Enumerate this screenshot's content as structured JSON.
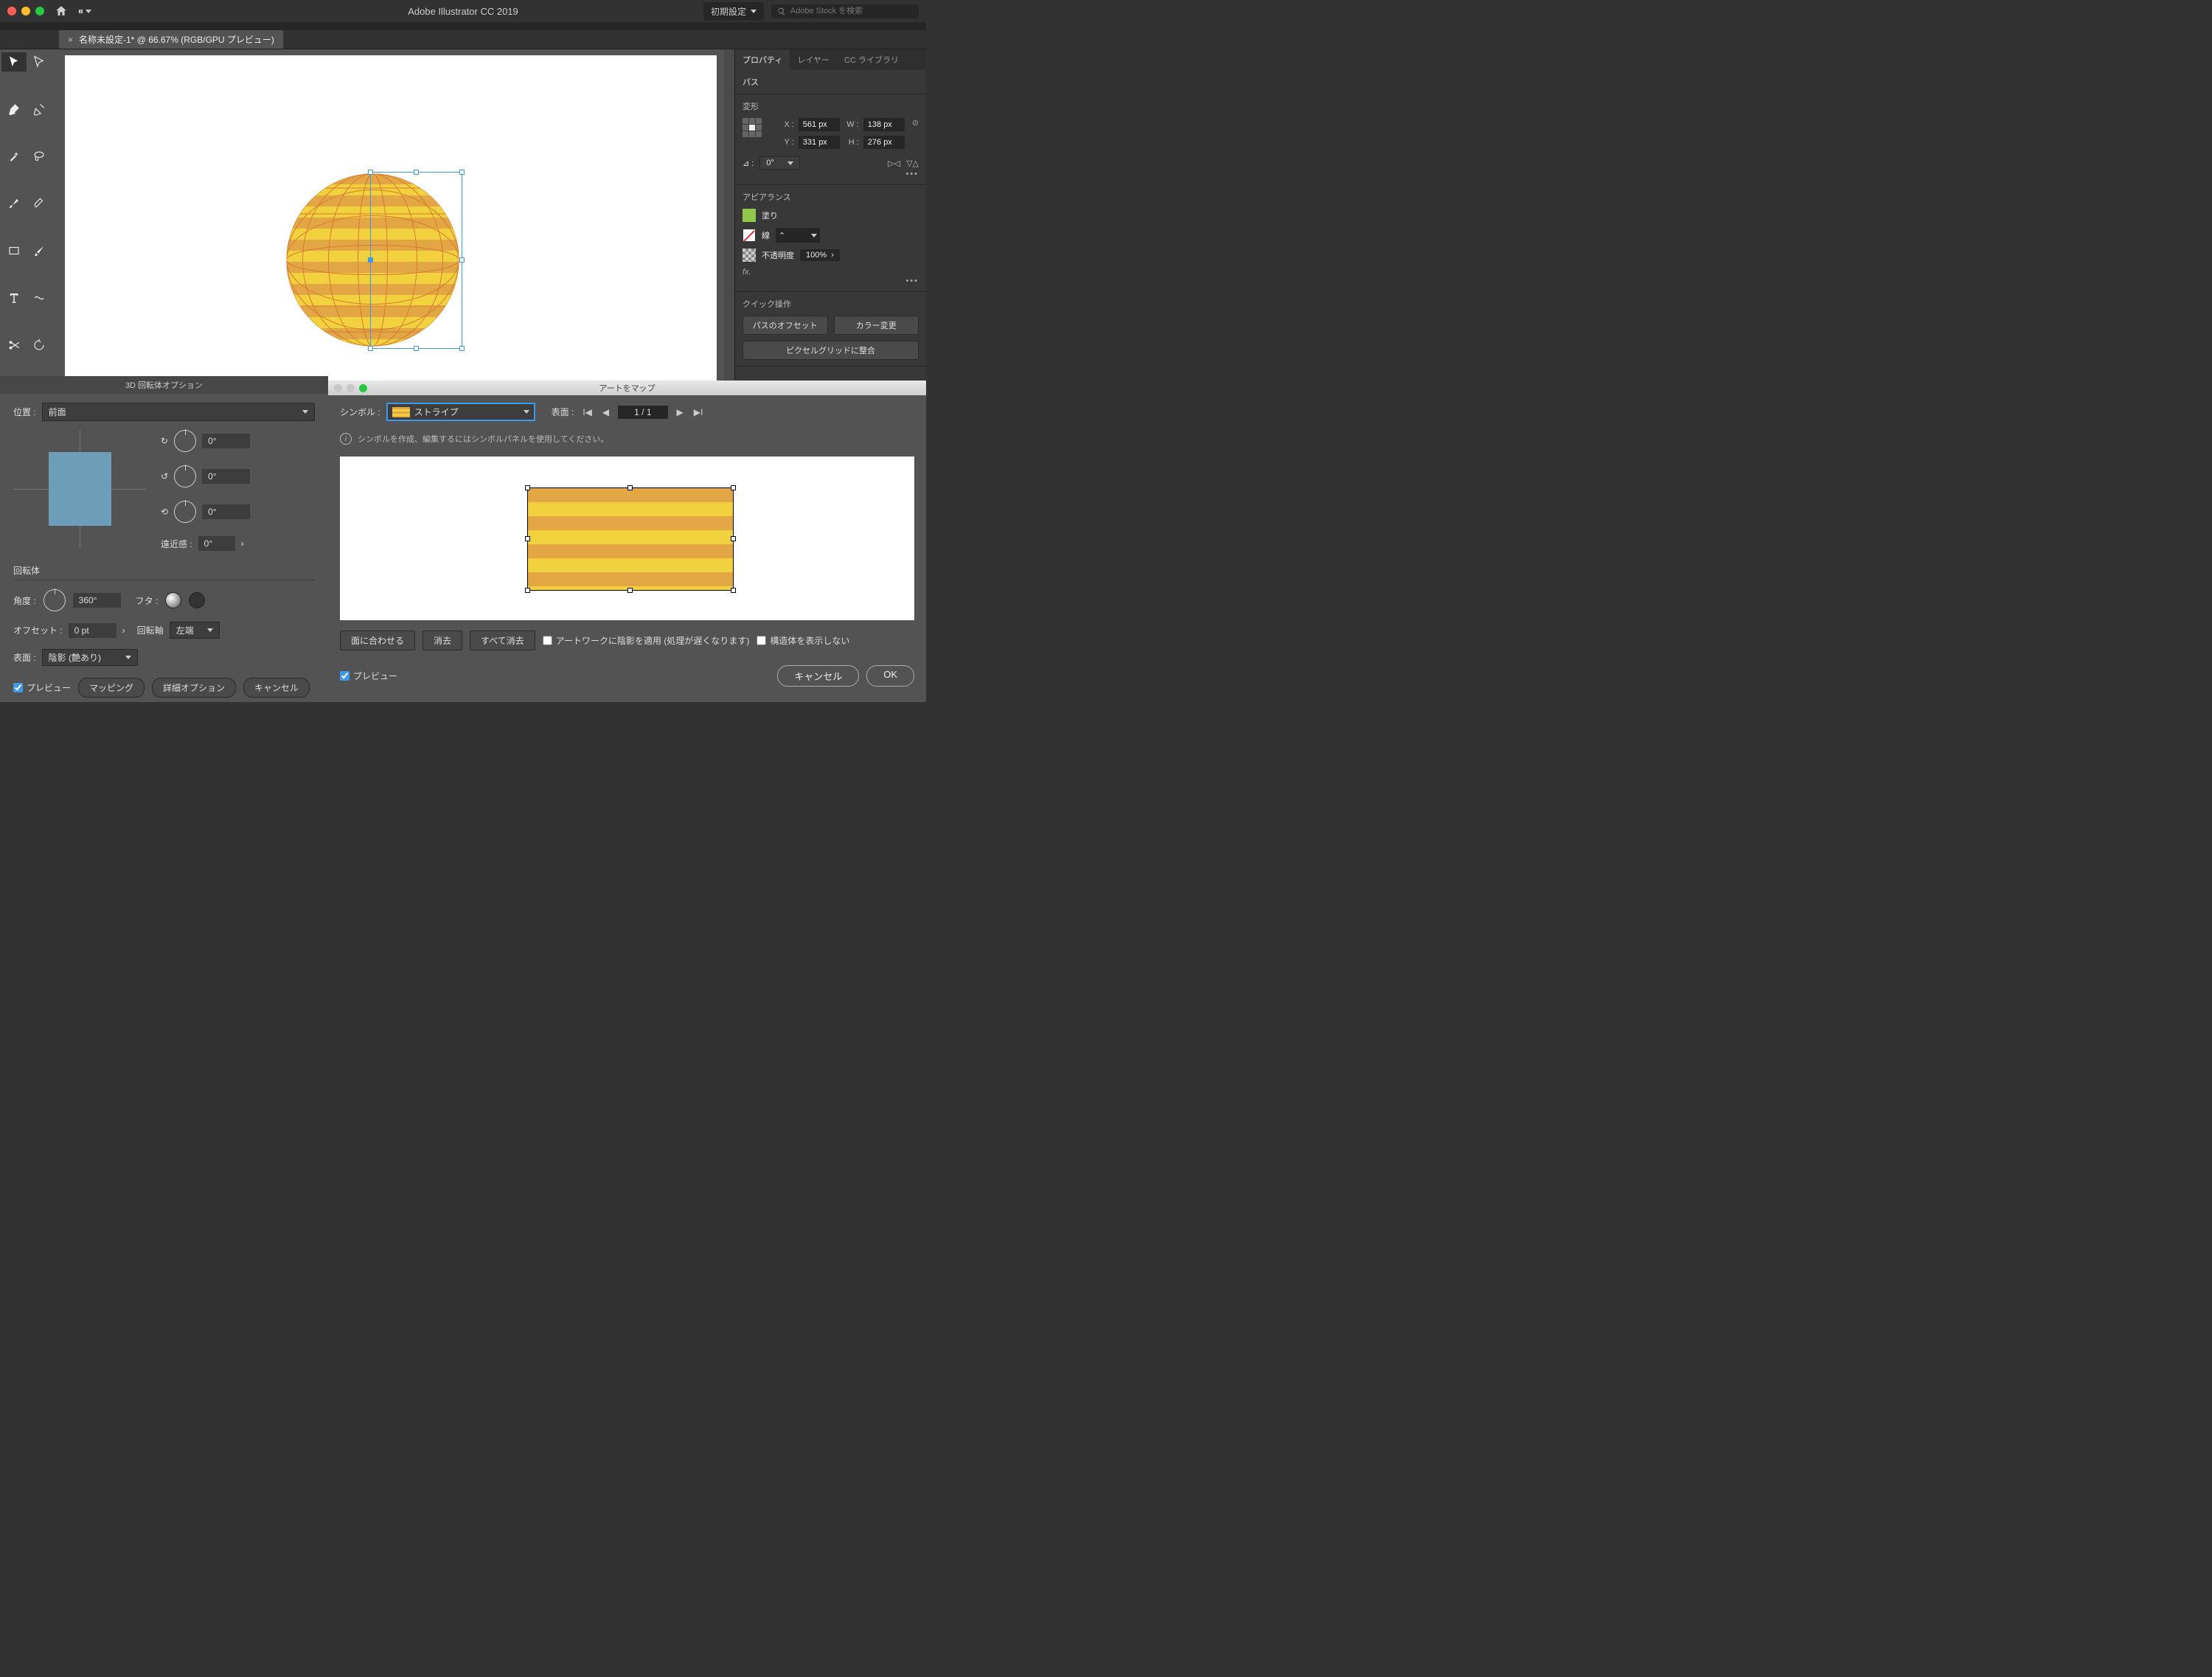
{
  "app_title": "Adobe Illustrator CC 2019",
  "workspace": "初期設定",
  "search_placeholder": "Adobe Stock を検索",
  "doc_tab": "名称未設定-1* @ 66.67% (RGB/GPU プレビュー)",
  "panels": {
    "tabs": [
      "プロパティ",
      "レイヤー",
      "CC ライブラリ"
    ],
    "path_label": "パス",
    "transform": {
      "title": "変形",
      "x_label": "X :",
      "x": "561 px",
      "y_label": "Y :",
      "y": "331 px",
      "w_label": "W :",
      "w": "138 px",
      "h_label": "H :",
      "h": "276 px",
      "angle_label": "⊿ :",
      "angle": "0°"
    },
    "appearance": {
      "title": "アピアランス",
      "fill_label": "塗り",
      "stroke_label": "線",
      "opacity_label": "不透明度",
      "opacity": "100%",
      "fx": "fx."
    },
    "quick": {
      "title": "クイック操作",
      "offset": "パスのオフセット",
      "recolor": "カラー変更",
      "pixel": "ピクセルグリッドに整合"
    }
  },
  "dlg3d": {
    "title": "3D 回転体オプション",
    "position_label": "位置 :",
    "position": "前面",
    "rot_x": "0°",
    "rot_y": "0°",
    "rot_z": "0°",
    "perspective_label": "遠近感 :",
    "perspective": "0°",
    "revolve_title": "回転体",
    "angle_label": "角度 :",
    "angle": "360°",
    "cap_label": "フタ :",
    "offset_label": "オフセット :",
    "offset": "0 pt",
    "axis_label": "回転軸",
    "axis": "左端",
    "surface_label": "表面 :",
    "surface": "陰影 (艶あり)",
    "preview": "プレビュー",
    "map": "マッピング",
    "more": "詳細オプション",
    "cancel": "キャンセル"
  },
  "dlgmap": {
    "title": "アートをマップ",
    "symbol_label": "シンボル :",
    "symbol": "ストライプ",
    "surface_label": "表面 :",
    "surface_num": "1 / 1",
    "info": "シンボルを作成、編集するにはシンボルパネルを使用してください。",
    "fit": "面に合わせる",
    "clear": "消去",
    "clear_all": "すべて消去",
    "shade": "アートワークに陰影を適用 (処理が遅くなります)",
    "geom": "構造体を表示しない",
    "preview": "プレビュー",
    "cancel": "キャンセル",
    "ok": "OK"
  }
}
